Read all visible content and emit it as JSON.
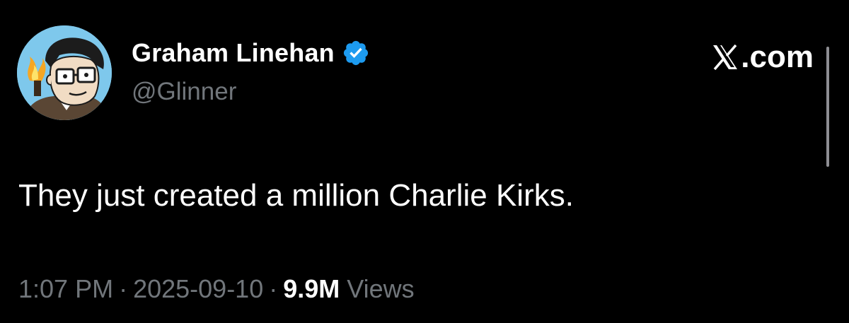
{
  "author": {
    "display_name": "Graham Linehan",
    "handle": "@Glinner",
    "verified": true,
    "avatar_icon": "cartoon-avatar"
  },
  "brand": {
    "text": ".com",
    "logo_icon": "x-logo-icon"
  },
  "tweet": {
    "text": "They just created a million Charlie Kirks."
  },
  "meta": {
    "time": "1:07 PM",
    "separator": "·",
    "date": "2025-09-10",
    "views_count": "9.9M",
    "views_label": "Views"
  },
  "colors": {
    "background": "#000000",
    "primary_text": "#ffffff",
    "secondary_text": "#71767b",
    "verified_blue": "#1d9bf0",
    "avatar_bg": "#7ec8ec"
  }
}
